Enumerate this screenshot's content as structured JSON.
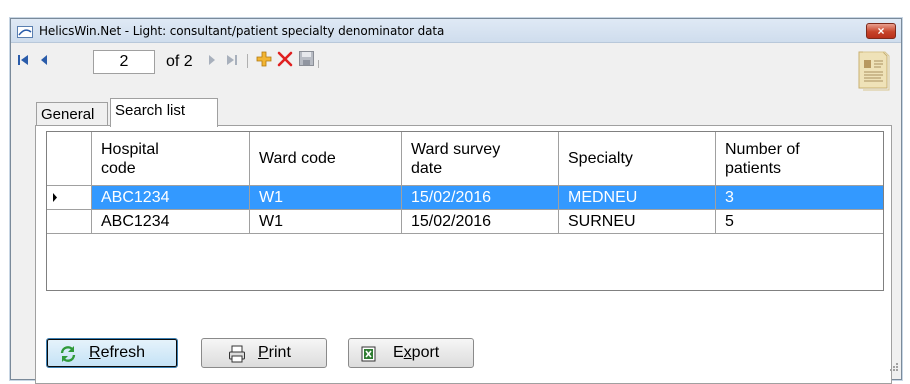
{
  "window": {
    "title": "HelicsWin.Net - Light: consultant/patient specialty denominator data",
    "close_label": "×"
  },
  "toolbar": {
    "record_position": "2",
    "of_label": "of 2"
  },
  "tabs": [
    {
      "label": "General"
    },
    {
      "label": "Search list"
    }
  ],
  "grid": {
    "columns": [
      {
        "label": "Hospital\ncode"
      },
      {
        "label": "Ward code"
      },
      {
        "label": "Ward survey\ndate"
      },
      {
        "label": "Specialty"
      },
      {
        "label": "Number of\npatients"
      }
    ],
    "rows": [
      {
        "hospital_code": "ABC1234",
        "ward_code": "W1",
        "ward_survey_date": "15/02/2016",
        "specialty": "MEDNEU",
        "number_of_patients": "3",
        "selected": true
      },
      {
        "hospital_code": "ABC1234",
        "ward_code": "W1",
        "ward_survey_date": "15/02/2016",
        "specialty": "SURNEU",
        "number_of_patients": "5",
        "selected": false
      }
    ]
  },
  "buttons": {
    "refresh_first": "R",
    "refresh_rest": "efresh",
    "print_first": "P",
    "print_rest": "rint",
    "export_pre": "E",
    "export_ul": "x",
    "export_rest": "port"
  },
  "colors": {
    "selection": "#3399ff",
    "close_button": "#c7432a",
    "nav_icon": "#2a5caa",
    "add_icon": "#e8a417",
    "delete_icon": "#e02020"
  }
}
